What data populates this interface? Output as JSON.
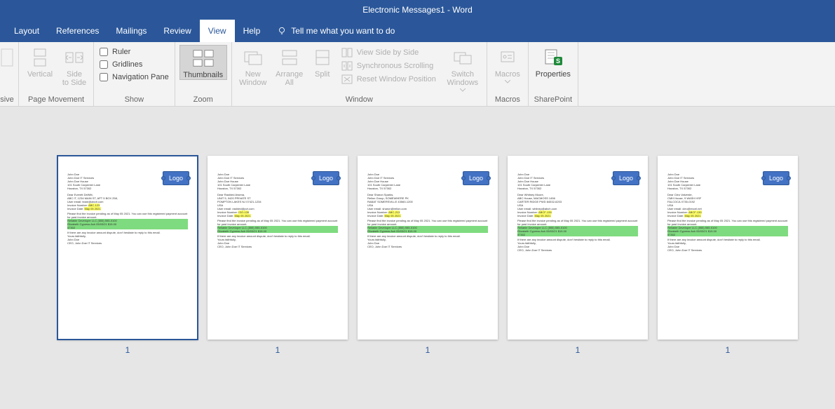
{
  "title": "Electronic Messages1  -  Word",
  "tabs": {
    "layout": "Layout",
    "references": "References",
    "mailings": "Mailings",
    "review": "Review",
    "view": "View",
    "help": "Help",
    "tellme": "Tell me what you want to do"
  },
  "ribbon": {
    "sive": "sive",
    "vertical": "Vertical",
    "sidetoside": "Side\nto Side",
    "pagemovement": "Page Movement",
    "ruler": "Ruler",
    "gridlines": "Gridlines",
    "navpane": "Navigation Pane",
    "show": "Show",
    "thumbnails": "Thumbnails",
    "zoom": "Zoom",
    "newwindow": "New\nWindow",
    "arrangeall": "Arrange\nAll",
    "split": "Split",
    "viewsbs": "View Side by Side",
    "syncscroll": "Synchronous Scrolling",
    "resetpos": "Reset Window Position",
    "switchwindows": "Switch\nWindows",
    "window": "Window",
    "macros": "Macros",
    "macrosgrp": "Macros",
    "properties": "Properties",
    "sharepoint": "SharePoint"
  },
  "logo": "Logo",
  "pagenum": "1",
  "pages": [
    {
      "header": [
        "John Doe",
        "John Doe IT Services",
        "John Doe House",
        "101 South Carpenter Lane",
        "Houston, TX 57302"
      ],
      "dear": "Dear Everett DeWitt,",
      "addr": [
        "ABC IT, 1234 MAIN ST, APT 5 BOX 258,",
        "User email: team@abcit.com"
      ],
      "invno_lbl": "Invoice Number:",
      "invno": "ABC-123",
      "invdt_lbl": "Invoice Date:",
      "invdt": "May 05 2021",
      "body": "Please find the invoice pending as of May 05 2021. You can use this registered payment account for past invoice amount.",
      "g1": "Reliable Developer LLC (555) 555-0100",
      "g2": "Elizabeth Cypress Ash 05/03/21 $15.00",
      "g3": "57302",
      "closing": "If there are any invoice amount dispute, don't hesitate to reply to this email.",
      "sig": [
        "Yours faithfully,",
        "John Doe",
        "CEO, John Doe IT Services"
      ]
    },
    {
      "header": [
        "John Doe",
        "John Doe IT Services",
        "John Doe House",
        "101 South Carpenter Lane",
        "Houston, TX 57302"
      ],
      "dear": "Dear Rashied Arsena,",
      "addr": [
        "UNIT 5, 0420 PRIVATE ST",
        "POMPTON LAKES NJ 07421-1234",
        "USA",
        "User email: rashied@pvt.com"
      ],
      "invno_lbl": "Invoice Number:",
      "invno": "ISO-139",
      "invdt_lbl": "Invoice Date:",
      "invdt": "May 05 2021",
      "body": "Please find the invoice pending as of May 05 2021. You can use this registered payment account for past invoice amount.",
      "g1": "Reliable Developer LLC (555) 555-0100",
      "g2": "Elizabeth Cypress Ash 05/03/21 $15.00",
      "g3": "",
      "closing": "If there are any invoice amount dispute, don't hesitate to reply to this email.",
      "sig": [
        "Yours faithfully,",
        "John Doe",
        "CEO, John Doe IT Services"
      ]
    },
    {
      "header": [
        "John Doe",
        "John Doe IT Services",
        "John Doe House",
        "101 South Carpenter Lane",
        "Houston, TX 57302"
      ],
      "dear": "Dear Sharon Sparks,",
      "addr": [
        "Relion Group, SOMEWHERE PK",
        "RABAT SOMERSVILLE 43560-1200",
        "USA",
        "User email: sharon@relion.com"
      ],
      "invno_lbl": "Invoice Number:",
      "invno": "ABC-213",
      "invdt_lbl": "Invoice Date:",
      "invdt": "May 05 2021",
      "body": "Please find the invoice pending as of May 05 2021. You can use this registered payment account for past invoice amount.",
      "g1": "Reliable Developer LLC (555) 555-0100",
      "g2": "Elizabeth Cypress Ash 05/03/21 $15.00",
      "g3": "",
      "closing": "If there are any invoice amount dispute, don't hesitate to reply to this email.",
      "sig": [
        "Yours faithfully,",
        "John Doe",
        "CEO, John Doe IT Services"
      ]
    },
    {
      "header": [
        "John Doe",
        "John Doe IT Services",
        "John Doe House",
        "101 South Carpenter Lane",
        "Houston, TX 57302"
      ],
      "dear": "Dear Whitney Moore,",
      "addr": [
        "ABC House, MACMOSS 1456",
        "CARTER RIDGE PWD 84532-6203",
        "USA",
        "User email: whitney@abch.com"
      ],
      "invno_lbl": "Invoice Number:",
      "invno": "ABCF-139",
      "invdt_lbl": "Invoice Date:",
      "invdt": "May 05 2021",
      "body": "Please find the invoice pending as of May 05 2021. You can use this registered payment account for past invoice amount.",
      "g1": "Reliable Developer LLC (555) 555-0100",
      "g2": "Elizabeth Cypress Ash 05/03/21 $15.00",
      "g3": "57302",
      "closing": "If there are any invoice amount dispute, don't hesitate to reply to this email.",
      "sig": [
        "Yours faithfully,",
        "John Doe",
        "CEO, John Doe IT Services"
      ]
    },
    {
      "header": [
        "John Doe",
        "John Doe IT Services",
        "John Doe House",
        "101 South Carpenter Lane",
        "Houston, TX 57302"
      ],
      "dear": "Dear Cleo Valverde,",
      "addr": [
        "CMH House, 9 WASH HSF",
        "FALCOCA X730-0192",
        "USA",
        "User email: cleo@excel.net"
      ],
      "invno_lbl": "Invoice Number:",
      "invno": "ABCF-130",
      "invdt_lbl": "Invoice Date:",
      "invdt": "May 05 2021",
      "body": "Please find the invoice pending as of May 05 2021. You can use this registered payment account for past invoice amount.",
      "g1": "Reliable Developer LLC (555) 555-0100",
      "g2": "Elizabeth Cypress Ash 05/03/21 $15.00",
      "g3": "57302",
      "closing": "If there are any invoice amount dispute, don't hesitate to reply to this email.",
      "sig": [
        "Yours faithfully,",
        "John Doe",
        "CEO, John Doe IT Services"
      ]
    }
  ]
}
